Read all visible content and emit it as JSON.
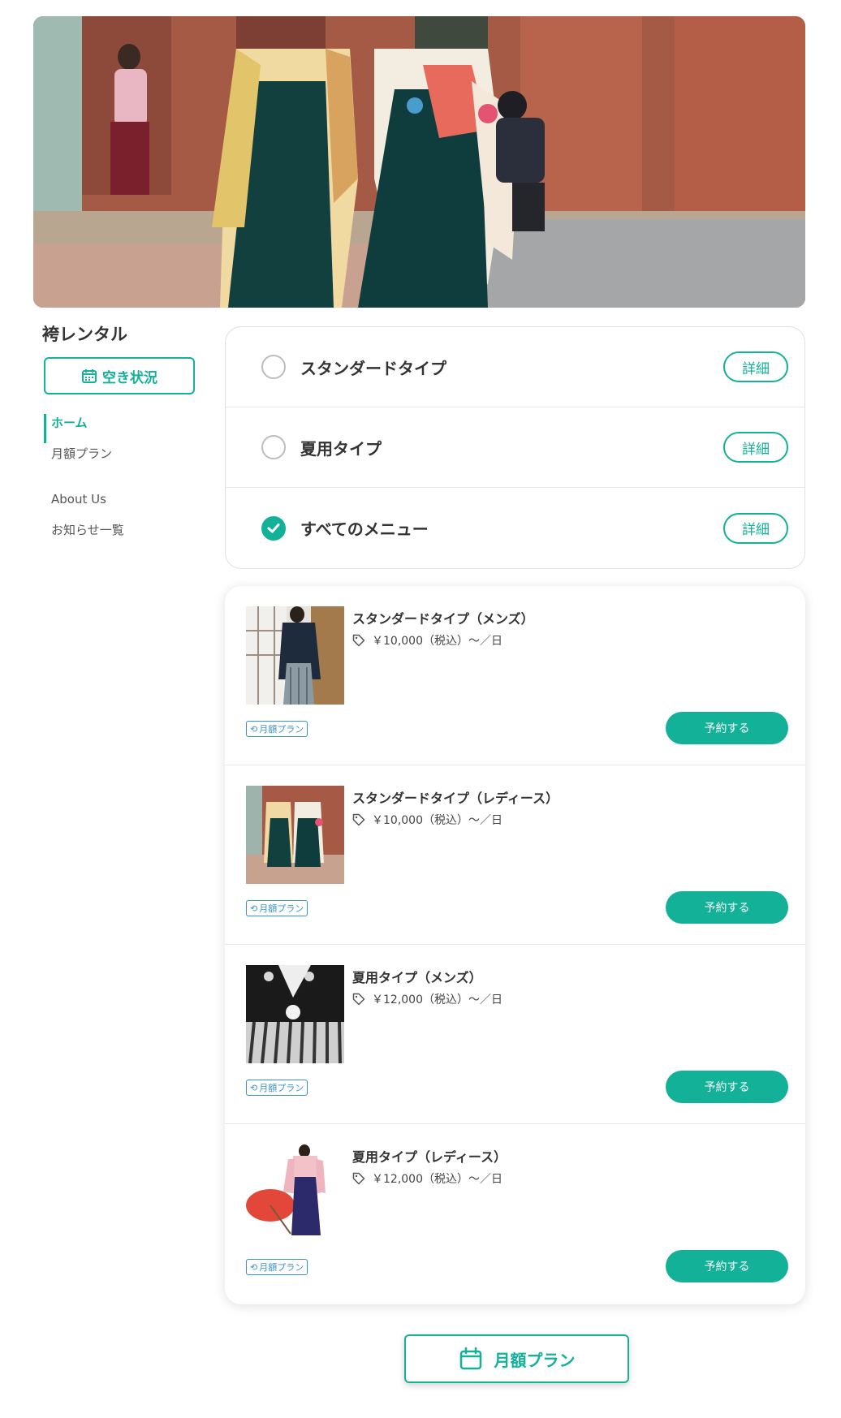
{
  "hero": {
    "alt": ""
  },
  "sidebar": {
    "shop_name": "袴レンタル",
    "availability_label": "空き状況",
    "nav": [
      {
        "label": "ホーム",
        "active": true
      },
      {
        "label": "月額プラン",
        "active": false
      },
      {
        "label": "About Us",
        "active": false
      },
      {
        "label": "お知らせ一覧",
        "active": false
      }
    ]
  },
  "filters": [
    {
      "label": "スタンダードタイプ",
      "checked": false,
      "detail": "詳細"
    },
    {
      "label": "夏用タイプ",
      "checked": false,
      "detail": "詳細"
    },
    {
      "label": "すべてのメニュー",
      "checked": true,
      "detail": "詳細"
    }
  ],
  "products": [
    {
      "name": "スタンダードタイプ（メンズ）",
      "price": "￥10,000（税込）〜／日",
      "badge": "月額プラン",
      "reserve": "予約する"
    },
    {
      "name": "スタンダードタイプ（レディース）",
      "price": "￥10,000（税込）〜／日",
      "badge": "月額プラン",
      "reserve": "予約する"
    },
    {
      "name": "夏用タイプ（メンズ）",
      "price": "￥12,000（税込）〜／日",
      "badge": "月額プラン",
      "reserve": "予約する"
    },
    {
      "name": "夏用タイプ（レディース）",
      "price": "￥12,000（税込）〜／日",
      "badge": "月額プラン",
      "reserve": "予約する"
    }
  ],
  "footer": {
    "monthly_plan_label": "月額プラン"
  },
  "colors": {
    "accent": "#13b198",
    "badge": "#3a92c9"
  }
}
